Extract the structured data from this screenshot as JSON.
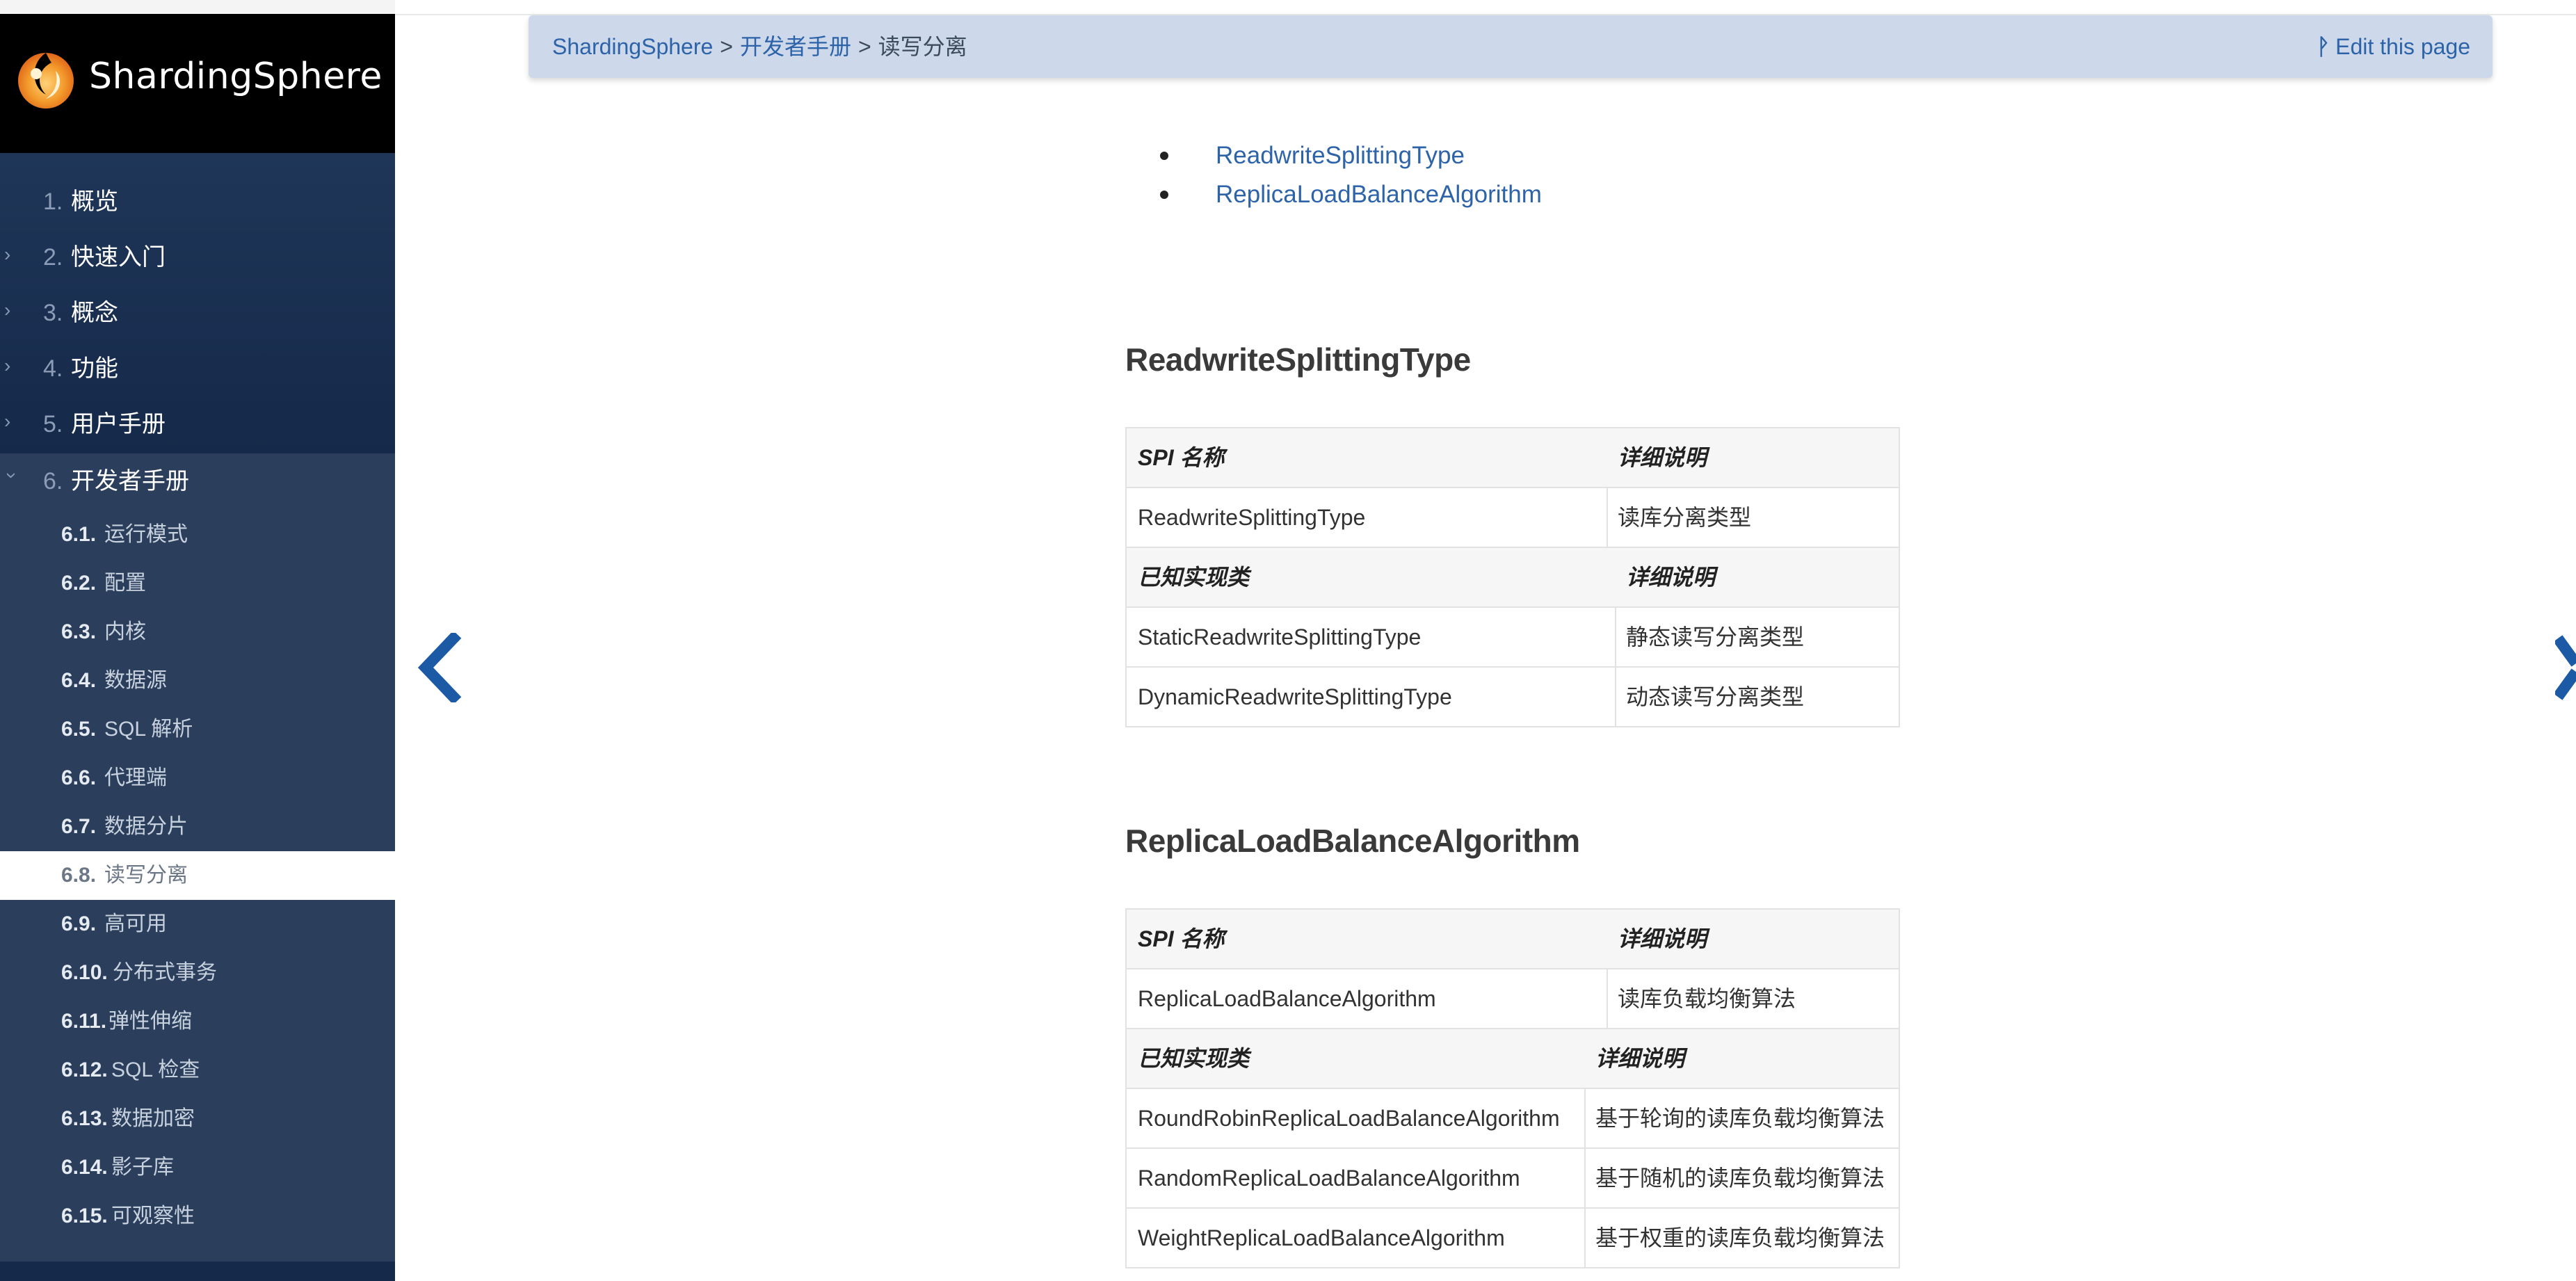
{
  "sidebar": {
    "logo_text": "ShardingSphere",
    "top_items": [
      {
        "num": "1.",
        "label": "概览",
        "expandable": false
      },
      {
        "num": "2.",
        "label": "快速入门",
        "expandable": true
      },
      {
        "num": "3.",
        "label": "概念",
        "expandable": true
      },
      {
        "num": "4.",
        "label": "功能",
        "expandable": true
      },
      {
        "num": "5.",
        "label": "用户手册",
        "expandable": true
      },
      {
        "num": "6.",
        "label": "开发者手册",
        "expandable": true,
        "expanded": true
      }
    ],
    "sub_items": [
      {
        "num": "6.1.",
        "label": "运行模式"
      },
      {
        "num": "6.2.",
        "label": "配置"
      },
      {
        "num": "6.3.",
        "label": "内核"
      },
      {
        "num": "6.4.",
        "label": "数据源"
      },
      {
        "num": "6.5.",
        "label": "SQL 解析"
      },
      {
        "num": "6.6.",
        "label": "代理端"
      },
      {
        "num": "6.7.",
        "label": "数据分片"
      },
      {
        "num": "6.8.",
        "label": "读写分离",
        "active": true
      },
      {
        "num": "6.9.",
        "label": "高可用"
      },
      {
        "num": "6.10.",
        "label": "分布式事务"
      },
      {
        "num": "6.11.",
        "label": "弹性伸缩"
      },
      {
        "num": "6.12.",
        "label": "SQL 检查"
      },
      {
        "num": "6.13.",
        "label": "数据加密"
      },
      {
        "num": "6.14.",
        "label": "影子库"
      },
      {
        "num": "6.15.",
        "label": "可观察性"
      }
    ]
  },
  "breadcrumb": {
    "root": "ShardingSphere",
    "parent": "开发者手册",
    "current": "读写分离",
    "separator": ">"
  },
  "edit_link": {
    "icon": "git-icon",
    "label": "Edit this page"
  },
  "toc": [
    "ReadwriteSplittingType",
    "ReplicaLoadBalanceAlgorithm"
  ],
  "sections": [
    {
      "title": "ReadwriteSplittingType",
      "spi_header": [
        "SPI 名称",
        "详细说明"
      ],
      "spi_row": [
        "ReadwriteSplittingType",
        "读库分离类型"
      ],
      "impl_header": [
        "已知实现类",
        "详细说明"
      ],
      "impl_rows": [
        [
          "StaticReadwriteSplittingType",
          "静态读写分离类型"
        ],
        [
          "DynamicReadwriteSplittingType",
          "动态读写分离类型"
        ]
      ]
    },
    {
      "title": "ReplicaLoadBalanceAlgorithm",
      "spi_header": [
        "SPI 名称",
        "详细说明"
      ],
      "spi_row": [
        "ReplicaLoadBalanceAlgorithm",
        "读库负载均衡算法"
      ],
      "impl_header": [
        "已知实现类",
        "详细说明"
      ],
      "impl_rows": [
        [
          "RoundRobinReplicaLoadBalanceAlgorithm",
          "基于轮询的读库负载均衡算法"
        ],
        [
          "RandomReplicaLoadBalanceAlgorithm",
          "基于随机的读库负载均衡算法"
        ],
        [
          "WeightReplicaLoadBalanceAlgorithm",
          "基于权重的读库负载均衡算法"
        ]
      ]
    }
  ],
  "colors": {
    "sidebar": "#1b2d4b",
    "sidebar_sub": "#2b3f5d",
    "link": "#2d63a8",
    "breadcrumb_bg": "#cdd9ea",
    "arrow": "#1d5aa6"
  }
}
